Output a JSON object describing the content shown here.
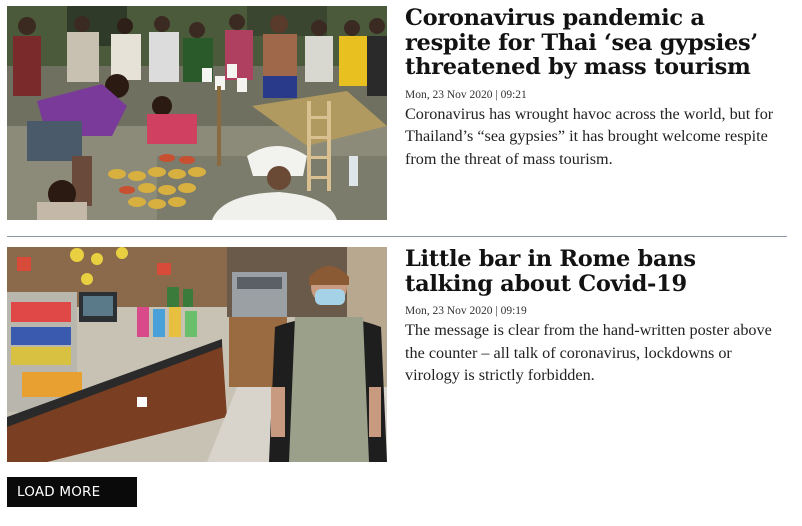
{
  "articles": [
    {
      "headline": "Coronavirus pandemic a respite for Thai ‘sea gypsies’ threatened by mass tourism",
      "timestamp": "Mon, 23 Nov 2020 | 09:21",
      "summary": "Coronavirus has wrought havoc across the world, but for Thailand’s “sea gypsies” it has brought welcome respite from the threat of mass tourism."
    },
    {
      "headline": "Little bar in Rome bans talking about Covid-19",
      "timestamp": "Mon, 23 Nov 2020 | 09:19",
      "summary": "The message is clear from the hand-written poster above the counter – all talk of coronavirus, lockdowns or virology is strictly forbidden."
    }
  ],
  "load_more_label": "LOAD MORE",
  "colors": {
    "divider": "#8a9aa8",
    "button_bg": "#0a0a0a",
    "button_text": "#ffffff",
    "headline": "#121212"
  }
}
